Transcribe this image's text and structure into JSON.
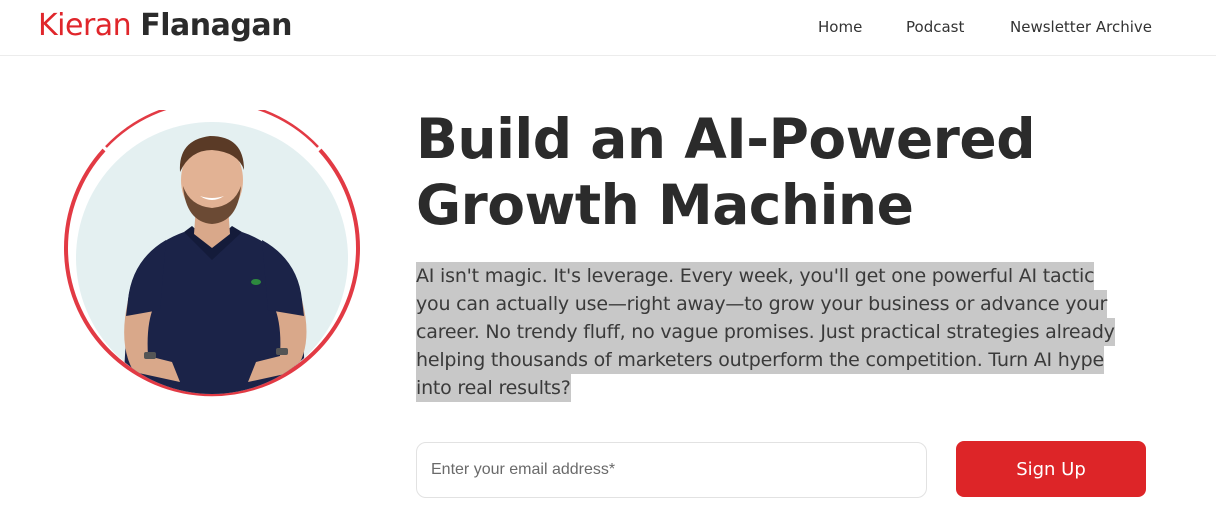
{
  "header": {
    "logo": {
      "first": "Kieran",
      "last": "Flanagan"
    },
    "nav": [
      {
        "label": "Home"
      },
      {
        "label": "Podcast"
      },
      {
        "label": "Newsletter Archive"
      }
    ]
  },
  "hero": {
    "headline": [
      "Build an AI-Powered",
      "Growth Machine"
    ],
    "description_lines": [
      "AI isn't magic. It's leverage. Every week, you'll get one powerful AI tactic",
      "you can actually use—right away—to grow your business or advance your",
      "career. No trendy fluff, no vague promises. Just practical strategies already",
      "helping thousands of marketers outperform the competition. Turn AI hype",
      "into real results?"
    ],
    "form": {
      "email_placeholder": "Enter your email address*",
      "email_value": "",
      "submit_label": "Sign Up"
    }
  },
  "colors": {
    "brand_red": "#dd2528",
    "text_dark": "#2b2b2b",
    "selection_highlight": "#c8c8c8"
  }
}
